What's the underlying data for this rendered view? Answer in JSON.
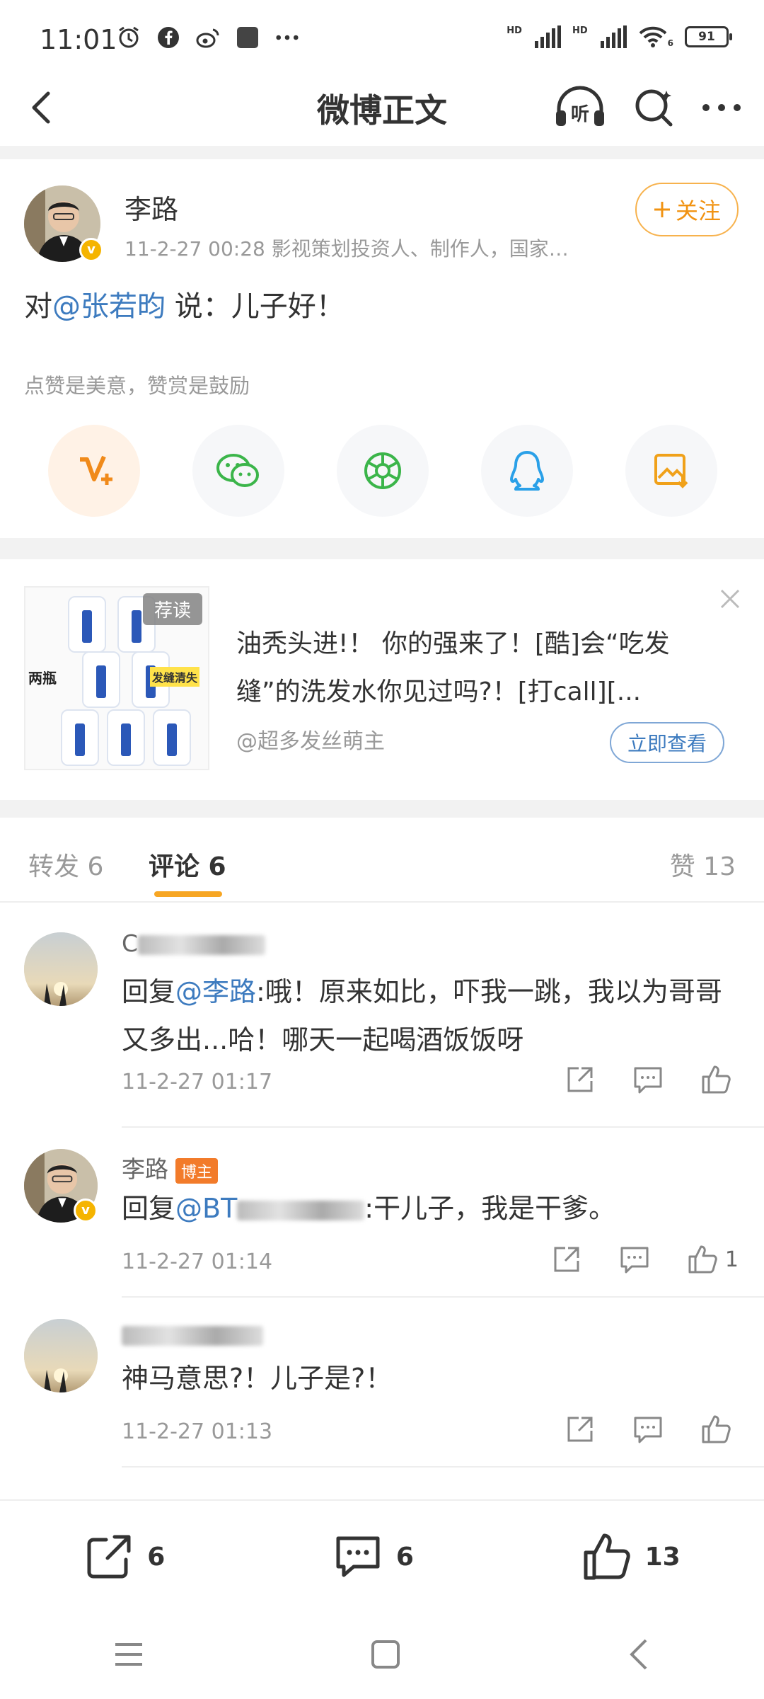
{
  "status_bar": {
    "time": "11:01",
    "battery": "91",
    "network_1": "HD",
    "network_2": "HD",
    "wifi_badge": "6"
  },
  "nav": {
    "title": "微博正文"
  },
  "post": {
    "author": "李路",
    "meta": "11-2-27 00:28  影视策划投资人、制作人，国家…",
    "follow_label": "关注",
    "content_prefix": "对",
    "content_mention": "@张若昀",
    "content_suffix": " 说：儿子好！",
    "reward_tip": "点赞是美意，赞赏是鼓励"
  },
  "ad": {
    "tag": "荐读",
    "text": "油秃头进!！ 你的强来了！[酷]会“吃发缝”的洗发水你见过吗?！[打call][...",
    "source": "@超多发丝萌主",
    "button": "立即查看",
    "img_label_1": "两瓶",
    "img_label_2": "发缝清失"
  },
  "tabs": {
    "repost": "转发 6",
    "comments": "评论 6",
    "likes": "赞 13"
  },
  "comments": [
    {
      "name_prefix": "C",
      "text_prefix": "回复",
      "mention": "@李路",
      "text": ":哦！原来如比，吓我一跳，我以为哥哥又多出...哈！哪天一起喝酒饭饭呀",
      "time": "11-2-27 01:17",
      "likes": ""
    },
    {
      "name": "李路",
      "badge": "博主",
      "text_prefix": "回复",
      "mention": "@BT",
      "text": ":干儿子，我是干爹。",
      "time": "11-2-27 01:14",
      "likes": "1"
    },
    {
      "text": "神马意思?！儿子是?！",
      "time": "11-2-27 01:13",
      "likes": ""
    }
  ],
  "bottom_bar": {
    "repost_count": "6",
    "comment_count": "6",
    "like_count": "13"
  }
}
